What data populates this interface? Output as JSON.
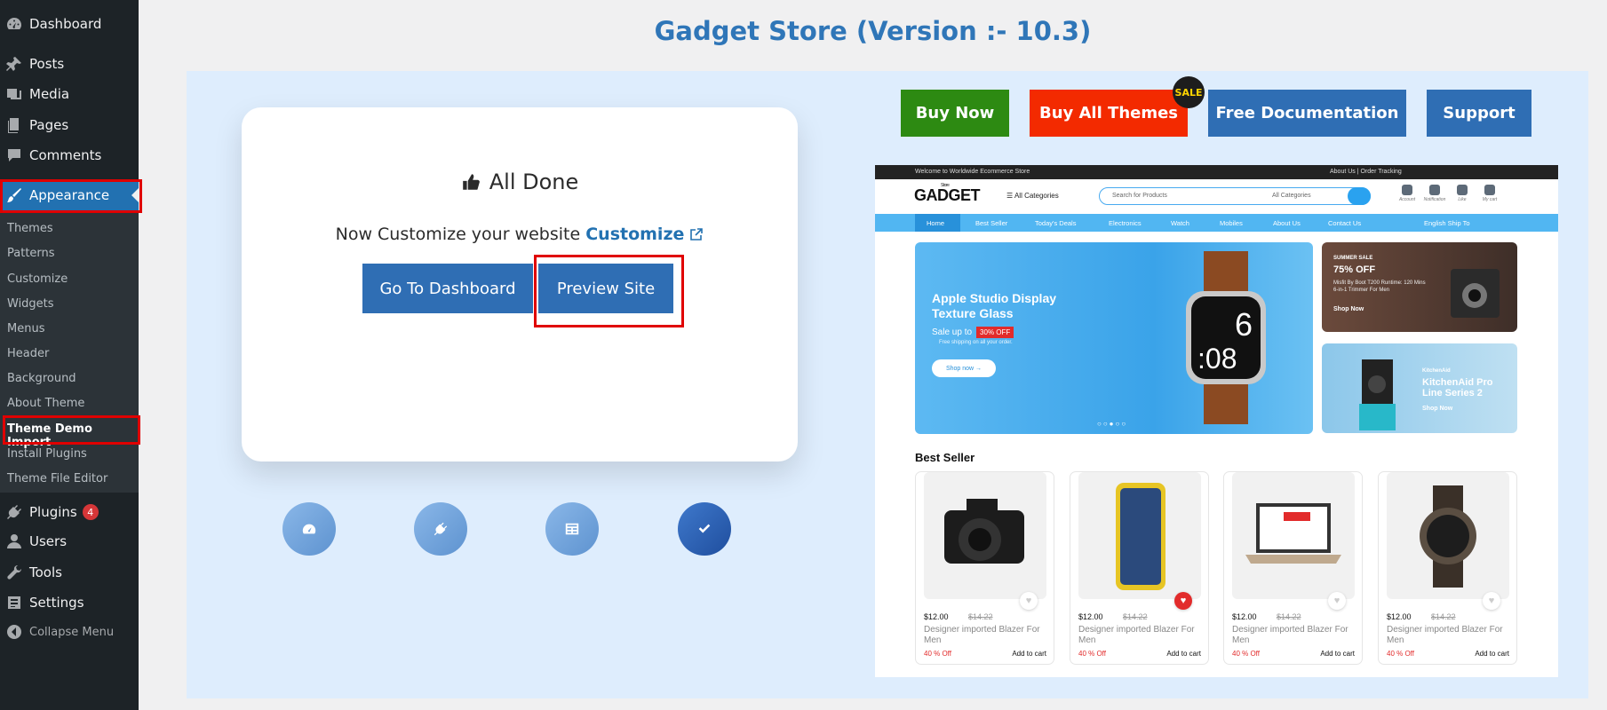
{
  "sidebar": {
    "top_items": [
      {
        "label": "Dashboard",
        "icon": "dashboard-icon"
      },
      {
        "label": "Posts",
        "icon": "pushpin-icon"
      },
      {
        "label": "Media",
        "icon": "media-icon"
      },
      {
        "label": "Pages",
        "icon": "pages-icon"
      },
      {
        "label": "Comments",
        "icon": "comment-icon"
      },
      {
        "label": "Appearance",
        "icon": "paintbrush-icon"
      }
    ],
    "appearance_sub": [
      "Themes",
      "Patterns",
      "Customize",
      "Widgets",
      "Menus",
      "Header",
      "Background",
      "About Theme",
      "Theme Demo Import",
      "Install Plugins",
      "Theme File Editor"
    ],
    "bottom_items": [
      {
        "label": "Plugins",
        "icon": "plugin-icon",
        "badge": "4"
      },
      {
        "label": "Users",
        "icon": "users-icon"
      },
      {
        "label": "Tools",
        "icon": "wrench-icon"
      },
      {
        "label": "Settings",
        "icon": "settings-icon"
      }
    ],
    "collapse": "Collapse Menu"
  },
  "header": {
    "title": "Gadget Store (Version :- 10.3)"
  },
  "card": {
    "title": "All Done",
    "customize_text": "Now Customize your website",
    "customize_link": "Customize",
    "dashboard_button": "Go To Dashboard",
    "preview_button": "Preview Site"
  },
  "top_buttons": {
    "buy_now": "Buy Now",
    "buy_all": "Buy All Themes",
    "sale": "SALE",
    "docs": "Free Documentation",
    "support": "Support"
  },
  "colors": {
    "accent": "#2271b1",
    "buy_now": "#2d8a12",
    "buy_all": "#f32a00",
    "highlight": "#e00000"
  },
  "preview": {
    "topbar_left": "Welcome to Worldwide Ecommerce Store",
    "topbar_right": "About Us  |  Order Tracking",
    "logo": "GADGET",
    "logo_small": "Store",
    "all_categories": "All Categories",
    "search_placeholder": "Search for Products",
    "search_dropdown": "All Categories",
    "icons": [
      "Account",
      "Notification",
      "Like",
      "My cart"
    ],
    "nav": [
      "Home",
      "Best Seller",
      "Today's Deals",
      "Electronics",
      "Watch",
      "Mobiles",
      "About Us",
      "Contact Us"
    ],
    "nav_right": "English  Ship To",
    "hero": {
      "title": "Apple Studio Display Texture Glass",
      "sale": "Sale up to",
      "pct": "30% OFF",
      "shipping": "Free shipping on all your order.",
      "shop": "Shop now",
      "time_top": "6",
      "time_bottom": ":08"
    },
    "side1": {
      "tag": "SUMMER SALE",
      "title": "75% OFF",
      "desc": "Misfit By Boot T200 Runtime: 120 Mins 6-in-1 Trimmer For Men",
      "shop": "Shop Now"
    },
    "side2": {
      "tag": "KitchenAid",
      "title": "KitchenAid Pro Line Series 2",
      "shop": "Shop Now"
    },
    "best_seller": "Best Seller",
    "products": [
      {
        "price": "$12.00",
        "old": "$14.22",
        "name": "Designer imported Blazer For Men",
        "off": "40 % Off",
        "cart": "Add to cart",
        "fav": false
      },
      {
        "price": "$12.00",
        "old": "$14.22",
        "name": "Designer imported Blazer For Men",
        "off": "40 % Off",
        "cart": "Add to cart",
        "fav": true
      },
      {
        "price": "$12.00",
        "old": "$14.22",
        "name": "Designer imported Blazer For Men",
        "off": "40 % Off",
        "cart": "Add to cart",
        "fav": false
      },
      {
        "price": "$12.00",
        "old": "$14.22",
        "name": "Designer imported Blazer For Men",
        "off": "40 % Off",
        "cart": "Add to cart",
        "fav": false
      }
    ]
  }
}
